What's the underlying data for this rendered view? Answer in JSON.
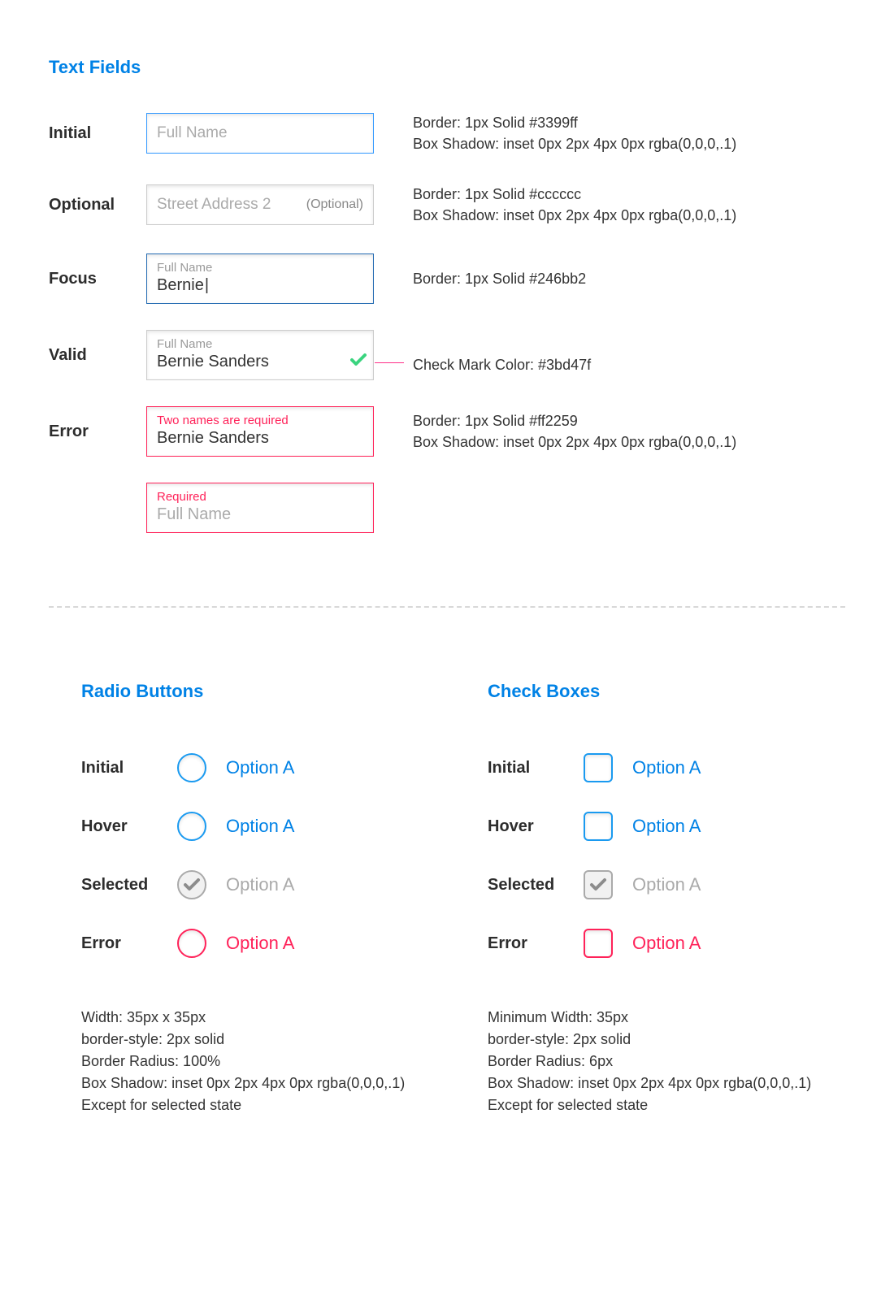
{
  "colors": {
    "heading_blue": "#0082e6",
    "initial_border": "#3399ff",
    "optional_border": "#cccccc",
    "focus_border": "#246bb2",
    "error_border": "#ff2259",
    "check_mark": "#3bd47f"
  },
  "text_fields": {
    "heading": "Text Fields",
    "rows": {
      "initial": {
        "state": "Initial",
        "placeholder": "Full Name",
        "annot_line1": "Border: 1px Solid #3399ff",
        "annot_line2": "Box Shadow: inset 0px 2px 4px 0px rgba(0,0,0,.1)"
      },
      "optional": {
        "state": "Optional",
        "placeholder": "Street Address 2",
        "tag": "(Optional)",
        "annot_line1": "Border: 1px Solid #cccccc",
        "annot_line2": "Box Shadow: inset 0px 2px 4px 0px rgba(0,0,0,.1)"
      },
      "focus": {
        "state": "Focus",
        "mini_label": "Full Name",
        "value": "Bernie",
        "annot_line1": "Border: 1px Solid #246bb2"
      },
      "valid": {
        "state": "Valid",
        "mini_label": "Full Name",
        "value": "Bernie Sanders",
        "annot_line1": "Check Mark Color: #3bd47f"
      },
      "error1": {
        "state": "Error",
        "mini_label": "Two names are required",
        "value": "Bernie Sanders",
        "annot_line1": "Border: 1px Solid #ff2259",
        "annot_line2": "Box Shadow: inset 0px 2px 4px 0px rgba(0,0,0,.1)"
      },
      "error2": {
        "mini_label": "Required",
        "placeholder": "Full Name"
      }
    }
  },
  "radio": {
    "heading": "Radio Buttons",
    "states": {
      "initial": {
        "label": "Initial",
        "option": "Option A"
      },
      "hover": {
        "label": "Hover",
        "option": "Option A"
      },
      "selected": {
        "label": "Selected",
        "option": "Option A"
      },
      "error": {
        "label": "Error",
        "option": "Option A"
      }
    },
    "spec": {
      "l1": "Width: 35px  x 35px",
      "l2": "border-style: 2px solid",
      "l3": "Border Radius: 100%",
      "l4": "Box Shadow: inset 0px 2px 4px 0px rgba(0,0,0,.1)",
      "l5": "Except for selected state"
    }
  },
  "checkbox": {
    "heading": "Check Boxes",
    "states": {
      "initial": {
        "label": "Initial",
        "option": "Option A"
      },
      "hover": {
        "label": "Hover",
        "option": "Option A"
      },
      "selected": {
        "label": "Selected",
        "option": "Option A"
      },
      "error": {
        "label": "Error",
        "option": "Option A"
      }
    },
    "spec": {
      "l1": "Minimum Width: 35px",
      "l2": "border-style: 2px solid",
      "l3": "Border Radius: 6px",
      "l4": "Box Shadow: inset 0px 2px 4px 0px rgba(0,0,0,.1)",
      "l5": "Except for selected state"
    }
  }
}
